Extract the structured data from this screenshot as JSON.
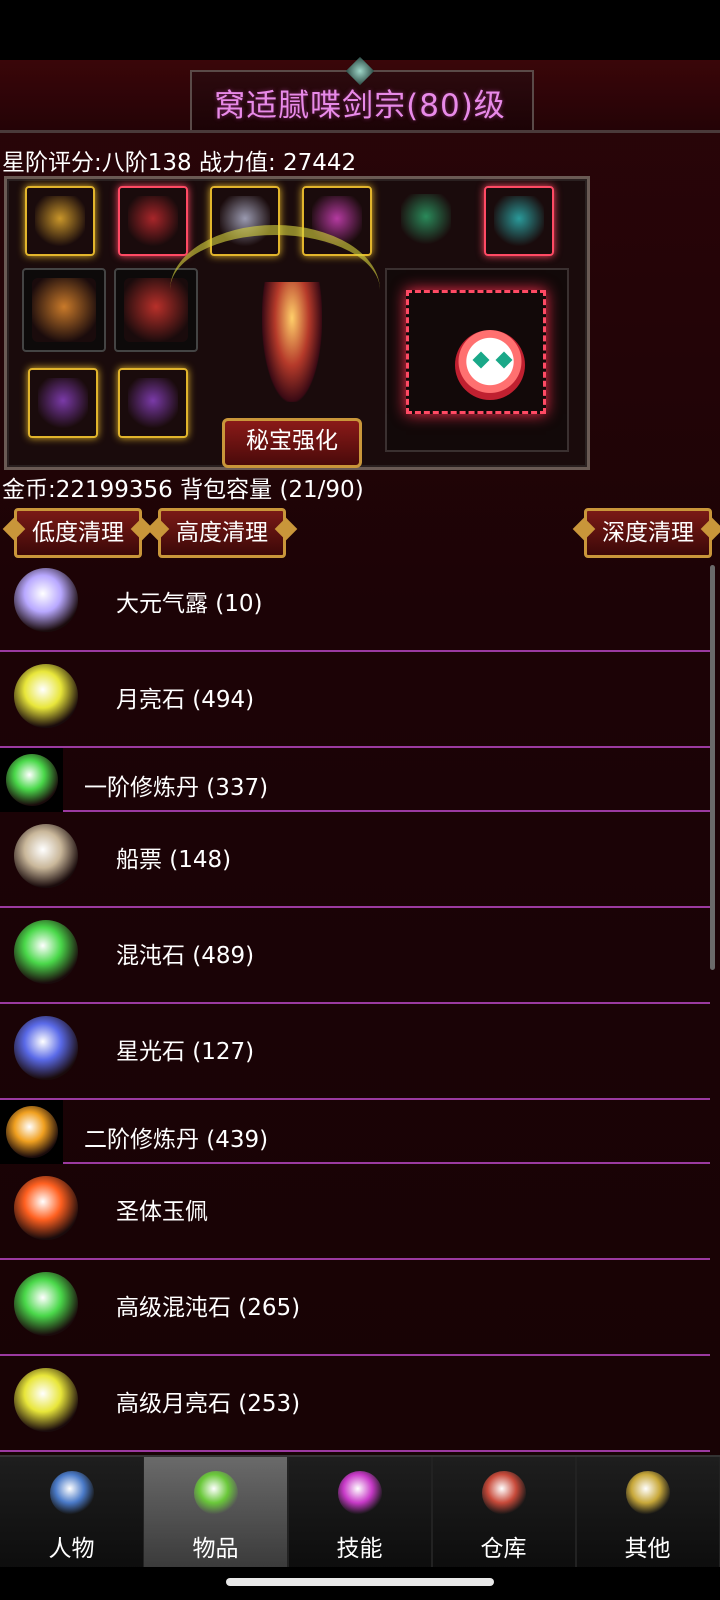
{
  "title": "窝适腻喋剑宗(80)级",
  "stats": {
    "text": "星阶评分:八阶138 战力值: 27442"
  },
  "equipment": {
    "slots": [
      {
        "name": "helmet-slot",
        "border": "gold",
        "color": "#c9962a"
      },
      {
        "name": "armor-slot",
        "border": "red",
        "color": "#a8262a"
      },
      {
        "name": "shoulder-slot",
        "border": "gold",
        "color": "#9a9ab0"
      },
      {
        "name": "wing-slot",
        "border": "gold",
        "color": "#b43aa0"
      },
      {
        "name": "pet-green-slot",
        "border": "none",
        "color": "#2a8a5a"
      },
      {
        "name": "mount-slot",
        "border": "red",
        "color": "#2a9a9a"
      },
      {
        "name": "weapon-slot-1",
        "border": "dark",
        "color": "#c97a2a"
      },
      {
        "name": "weapon-slot-2",
        "border": "dark",
        "color": "#b8302a"
      },
      {
        "name": "ring-slot-1",
        "border": "gold",
        "color": "#7a3aa8"
      },
      {
        "name": "ring-slot-2",
        "border": "gold",
        "color": "#7a3aa8"
      }
    ],
    "mibao_button": "秘宝强化"
  },
  "inventory": {
    "gold_text": "金币:22199356 背包容量 (21/90)",
    "buttons": {
      "low": "低度清理",
      "high": "高度清理",
      "deep": "深度清理"
    },
    "items": [
      {
        "label": "大元气露 (10)",
        "icon": "crystal-icon",
        "color": "#b8a8ff",
        "small": false
      },
      {
        "label": "月亮石 (494)",
        "icon": "moonstone-icon",
        "color": "#e8e63a",
        "small": false
      },
      {
        "label": "一阶修炼丹 (337)",
        "icon": "pill-green-icon",
        "color": "#4ad84a",
        "small": true
      },
      {
        "label": "船票 (148)",
        "icon": "scroll-icon",
        "color": "#c9b79a",
        "small": false
      },
      {
        "label": "混沌石 (489)",
        "icon": "chaos-stone-icon",
        "color": "#4ad84a",
        "small": false
      },
      {
        "label": "星光石 (127)",
        "icon": "starlight-stone-icon",
        "color": "#5a6ae8",
        "small": false
      },
      {
        "label": "二阶修炼丹 (439)",
        "icon": "pill-orange-icon",
        "color": "#f0a020",
        "small": true
      },
      {
        "label": "圣体玉佩",
        "icon": "jade-pendant-icon",
        "color": "#ff6020",
        "small": false
      },
      {
        "label": "高级混沌石 (265)",
        "icon": "adv-chaos-stone-icon",
        "color": "#4ad84a",
        "small": false
      },
      {
        "label": "高级月亮石 (253)",
        "icon": "adv-moonstone-icon",
        "color": "#e8e63a",
        "small": false
      }
    ]
  },
  "tabs": [
    {
      "label": "人物",
      "icon": "character-icon",
      "color": "#4a7ac8",
      "active": false
    },
    {
      "label": "物品",
      "icon": "potion-icon",
      "color": "#6ac83a",
      "active": true
    },
    {
      "label": "技能",
      "icon": "skill-orb-icon",
      "color": "#c83ac8",
      "active": false
    },
    {
      "label": "仓库",
      "icon": "warehouse-icon",
      "color": "#c84a3a",
      "active": false
    },
    {
      "label": "其他",
      "icon": "sword-icon",
      "color": "#c8a83a",
      "active": false
    }
  ]
}
